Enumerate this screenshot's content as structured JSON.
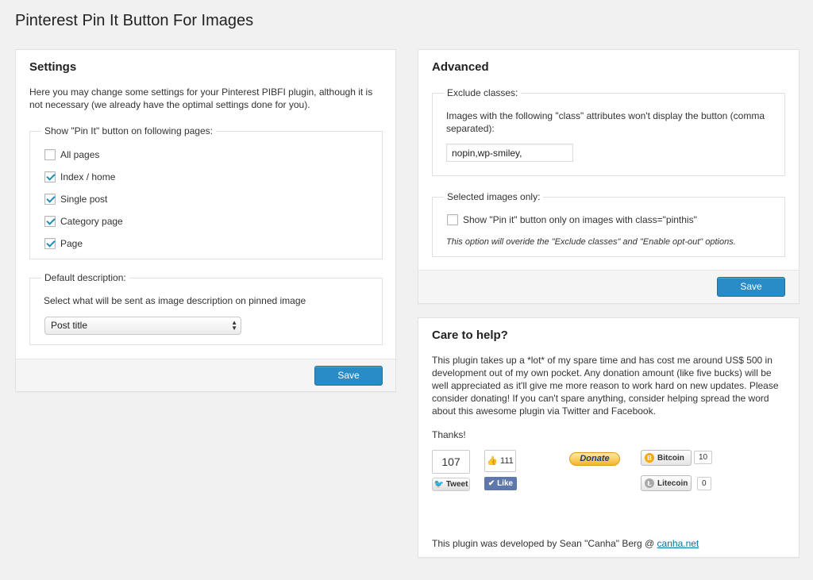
{
  "page_title": "Pinterest Pin It Button For Images",
  "settings": {
    "title": "Settings",
    "intro": "Here you may change some settings for your Pinterest PIBFI plugin, although it is not necessary (we already have the optimal settings done for you).",
    "show_on": {
      "legend": "Show \"Pin It\" button on following pages:",
      "options": [
        {
          "label": "All pages",
          "checked": false
        },
        {
          "label": "Index / home",
          "checked": true
        },
        {
          "label": "Single post",
          "checked": true
        },
        {
          "label": "Category page",
          "checked": true
        },
        {
          "label": "Page",
          "checked": true
        }
      ]
    },
    "description": {
      "legend": "Default description:",
      "help": "Select what will be sent as image description on pinned image",
      "selected": "Post title"
    },
    "save_label": "Save"
  },
  "advanced": {
    "title": "Advanced",
    "exclude": {
      "legend": "Exclude classes:",
      "help": "Images with the following \"class\" attributes won't display the button (comma separated):",
      "value": "nopin,wp-smiley,"
    },
    "selected_only": {
      "legend": "Selected images only:",
      "option_label": "Show \"Pin it\" button only on images with class=\"pinthis\"",
      "checked": false,
      "note": "This option will overide the \"Exclude classes\" and \"Enable opt-out\" options."
    },
    "save_label": "Save"
  },
  "help": {
    "title": "Care to help?",
    "body": "This plugin takes up a *lot* of my spare time and has cost me around US$ 500 in development out of my own pocket. Any donation amount (like five bucks) will be well appreciated as it'll give me more reason to work hard on new updates. Please consider donating! If you can't spare anything, consider helping spread the word about this awesome plugin via Twitter and Facebook.",
    "thanks": "Thanks!",
    "tweet_count": "107",
    "tweet_label": "Tweet",
    "like_count": "111",
    "like_label": "Like",
    "donate_label": "Donate",
    "bitcoin_label": "Bitcoin",
    "bitcoin_count": "10",
    "litecoin_label": "Litecoin",
    "litecoin_count": "0",
    "footer_prefix": "This plugin was developed by Sean \"Canha\" Berg @ ",
    "footer_link": "canha.net"
  }
}
